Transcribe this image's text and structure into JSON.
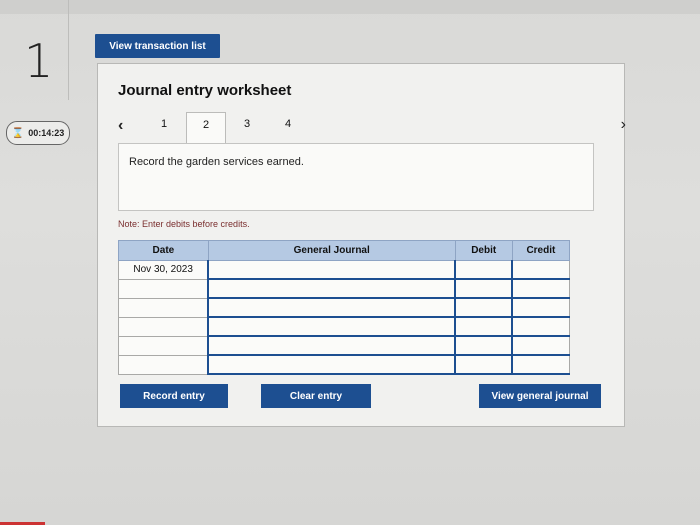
{
  "question": {
    "number": "1"
  },
  "timer": {
    "value": "00:14:23"
  },
  "top": {
    "view_transaction_list": "View transaction list"
  },
  "worksheet": {
    "title": "Journal entry worksheet",
    "tabs": [
      "1",
      "2",
      "3",
      "4"
    ],
    "active_tab": "2",
    "description": "Record the garden services earned.",
    "note": "Note: Enter debits before credits."
  },
  "table": {
    "headers": {
      "date": "Date",
      "general_journal": "General Journal",
      "debit": "Debit",
      "credit": "Credit"
    },
    "rows": [
      {
        "date": "Nov 30, 2023",
        "account": "",
        "debit": "",
        "credit": ""
      },
      {
        "date": "",
        "account": "",
        "debit": "",
        "credit": ""
      },
      {
        "date": "",
        "account": "",
        "debit": "",
        "credit": ""
      },
      {
        "date": "",
        "account": "",
        "debit": "",
        "credit": ""
      },
      {
        "date": "",
        "account": "",
        "debit": "",
        "credit": ""
      },
      {
        "date": "",
        "account": "",
        "debit": "",
        "credit": ""
      }
    ]
  },
  "buttons": {
    "record_entry": "Record entry",
    "clear_entry": "Clear entry",
    "view_general_journal": "View general journal"
  },
  "colors": {
    "accent": "#1d4f91",
    "header_bg": "#b5c9e3"
  },
  "icons": {
    "prev": "chevron-left-icon",
    "next": "chevron-right-icon",
    "timer": "hourglass-icon"
  }
}
